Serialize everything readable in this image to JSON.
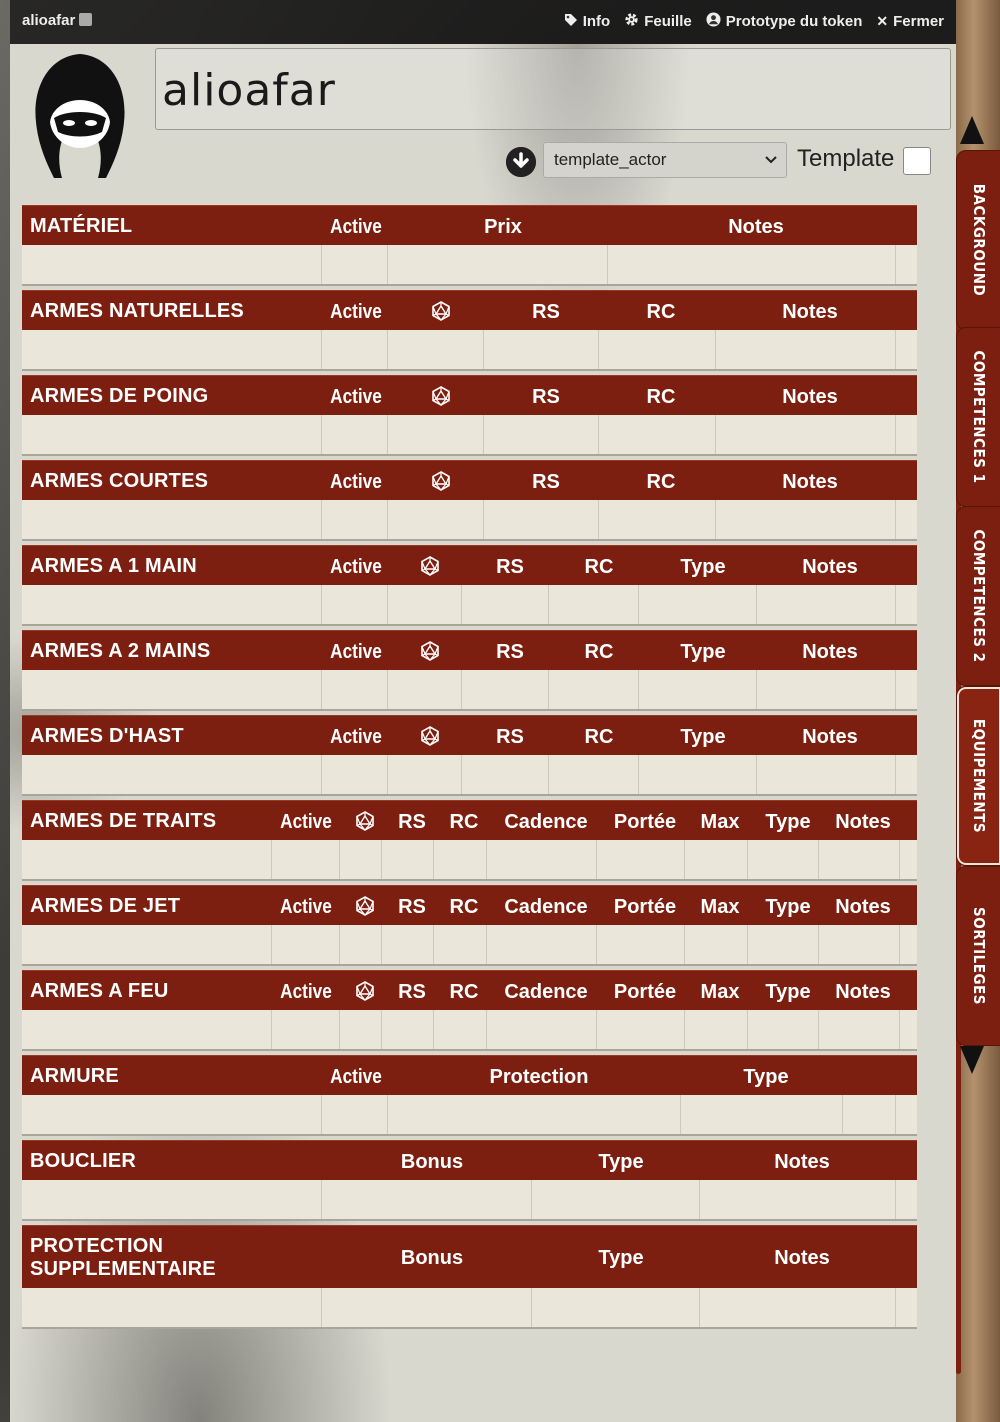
{
  "window": {
    "title": "alioafar",
    "controls": [
      {
        "label": "Info",
        "icon": "tag-icon"
      },
      {
        "label": "Feuille",
        "icon": "gear-icon"
      },
      {
        "label": "Prototype du token",
        "icon": "user-circle-icon"
      },
      {
        "label": "Fermer",
        "icon": "close-icon"
      }
    ]
  },
  "actor": {
    "name": "alioafar",
    "template_value": "template_actor",
    "template_label": "Template"
  },
  "tabs": [
    {
      "label": "BACKGROUND",
      "active": false
    },
    {
      "label": "COMPETENCES 1",
      "active": false
    },
    {
      "label": "COMPETENCES 2",
      "active": false
    },
    {
      "label": "EQUIPEMENTS",
      "active": true
    },
    {
      "label": "SORTILEGES",
      "active": false
    }
  ],
  "sections": {
    "materiel": {
      "title": "MATÉRIEL",
      "cols": [
        "Active",
        "Prix",
        "Notes"
      ]
    },
    "naturelles": {
      "title": "ARMES NATURELLES",
      "cols": [
        "Active",
        "RS",
        "RC",
        "Notes"
      ]
    },
    "poing": {
      "title": "ARMES DE POING",
      "cols": [
        "Active",
        "RS",
        "RC",
        "Notes"
      ]
    },
    "courtes": {
      "title": "ARMES COURTES",
      "cols": [
        "Active",
        "RS",
        "RC",
        "Notes"
      ]
    },
    "une_main": {
      "title": "ARMES A 1 MAIN",
      "cols": [
        "Active",
        "RS",
        "RC",
        "Type",
        "Notes"
      ]
    },
    "deux_mains": {
      "title": "ARMES A 2 MAINS",
      "cols": [
        "Active",
        "RS",
        "RC",
        "Type",
        "Notes"
      ]
    },
    "hast": {
      "title": "ARMES D'HAST",
      "cols": [
        "Active",
        "RS",
        "RC",
        "Type",
        "Notes"
      ]
    },
    "traits": {
      "title": "ARMES DE TRAITS",
      "cols": [
        "Active",
        "RS",
        "RC",
        "Cadence",
        "Portée",
        "Max",
        "Type",
        "Notes"
      ]
    },
    "jet": {
      "title": "ARMES DE JET",
      "cols": [
        "Active",
        "RS",
        "RC",
        "Cadence",
        "Portée",
        "Max",
        "Type",
        "Notes"
      ]
    },
    "feu": {
      "title": "ARMES A FEU",
      "cols": [
        "Active",
        "RS",
        "RC",
        "Cadence",
        "Portée",
        "Max",
        "Type",
        "Notes"
      ]
    },
    "armure": {
      "title": "ARMURE",
      "cols": [
        "Active",
        "Protection",
        "Type"
      ]
    },
    "bouclier": {
      "title": "BOUCLIER",
      "cols": [
        "Bonus",
        "Type",
        "Notes"
      ]
    },
    "protection": {
      "title_line1": "PROTECTION",
      "title_line2": "SUPPLEMENTAIRE",
      "cols": [
        "Bonus",
        "Type",
        "Notes"
      ]
    }
  }
}
